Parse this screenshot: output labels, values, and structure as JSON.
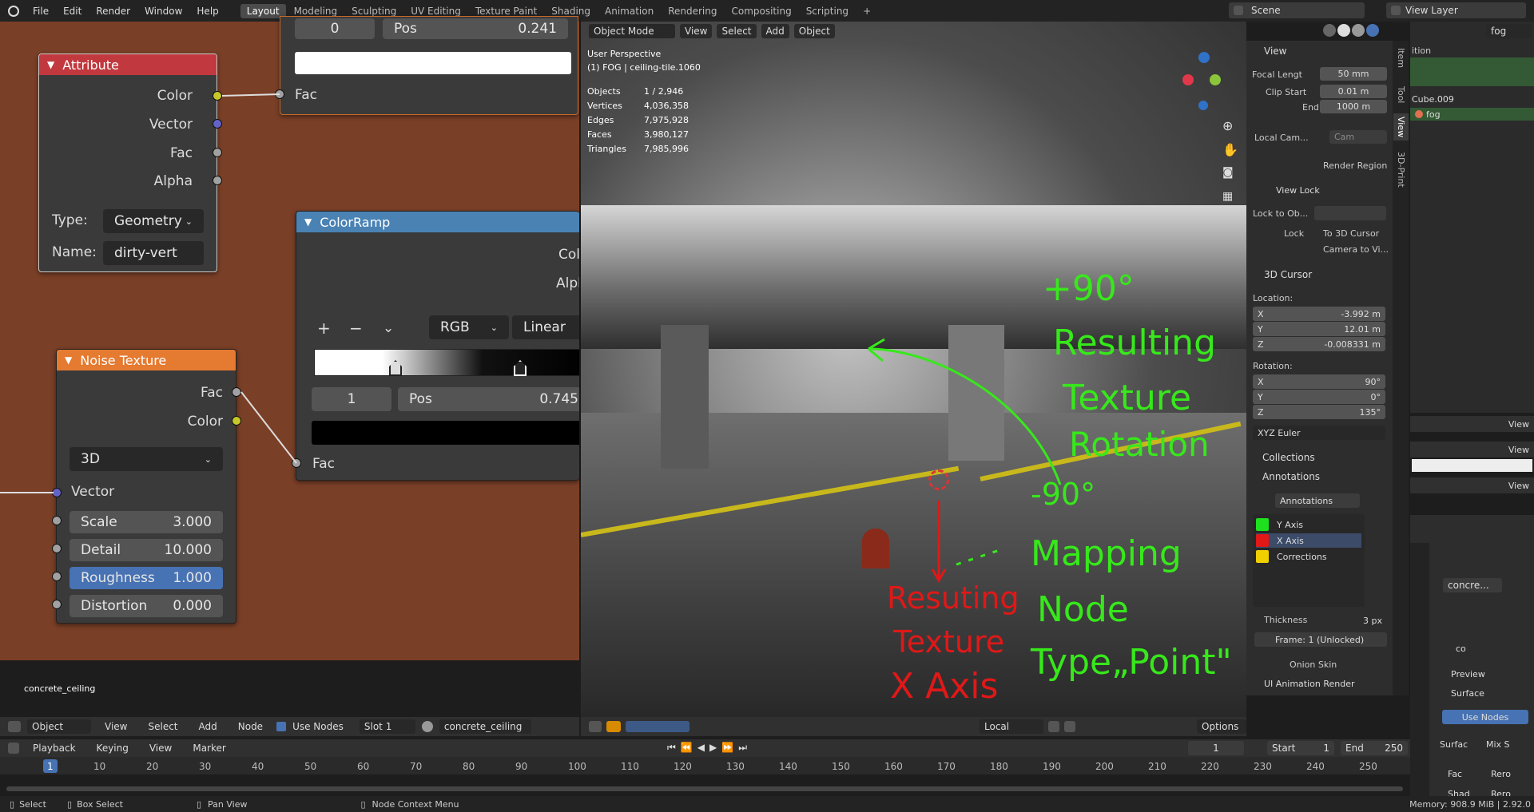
{
  "topbar": {
    "menus": [
      "File",
      "Edit",
      "Render",
      "Window",
      "Help"
    ],
    "workspaces": [
      "Layout",
      "Modeling",
      "Sculpting",
      "UV Editing",
      "Texture Paint",
      "Shading",
      "Animation",
      "Rendering",
      "Compositing",
      "Scripting"
    ],
    "add_tab": "+",
    "scene": "Scene",
    "view_layer": "View Layer"
  },
  "node_editor": {
    "material_name_overlay": "concrete_ceiling",
    "top_node": {
      "value_left": "0",
      "pos_label": "Pos",
      "pos_value": "0.241",
      "fac": "Fac"
    },
    "attribute": {
      "title": "Attribute",
      "outputs": [
        "Color",
        "Vector",
        "Fac",
        "Alpha"
      ],
      "type_label": "Type:",
      "type_value": "Geometry",
      "name_label": "Name:",
      "name_value": "dirty-vert"
    },
    "colorramp": {
      "title": "ColorRamp",
      "out_color": "Col",
      "out_alpha": "Alpl",
      "add": "+",
      "remove": "−",
      "mode": "RGB",
      "interp": "Linear",
      "index": "1",
      "pos_label": "Pos",
      "pos_value": "0.745",
      "fac": "Fac"
    },
    "noise": {
      "title": "Noise Texture",
      "out_fac": "Fac",
      "out_color": "Color",
      "dimensions": "3D",
      "vector": "Vector",
      "fields": [
        {
          "label": "Scale",
          "value": "3.000"
        },
        {
          "label": "Detail",
          "value": "10.000"
        },
        {
          "label": "Roughness",
          "value": "1.000"
        },
        {
          "label": "Distortion",
          "value": "0.000"
        }
      ]
    },
    "header": {
      "editor": "Object",
      "menus": [
        "View",
        "Select",
        "Add",
        "Node"
      ],
      "use_nodes": "Use Nodes",
      "slot": "Slot 1",
      "material": "concrete_ceiling"
    }
  },
  "viewport": {
    "mode": "Object Mode",
    "menus": [
      "View",
      "Select",
      "Add",
      "Object"
    ],
    "perspective": "User Perspective",
    "active": "(1) FOG | ceiling-tile.1060",
    "stats": [
      {
        "label": "Objects",
        "value": "1 / 2,946"
      },
      {
        "label": "Vertices",
        "value": "4,036,358"
      },
      {
        "label": "Edges",
        "value": "7,975,928"
      },
      {
        "label": "Faces",
        "value": "3,980,127"
      },
      {
        "label": "Triangles",
        "value": "7,985,996"
      }
    ],
    "transform": "Local",
    "options": "Options",
    "annotations": {
      "plus90": "+90°",
      "resulting": "Resulting",
      "texture": "Texture",
      "rotation": "Rotation",
      "minus90": "-90°",
      "mapping": "Mapping",
      "node": "Node",
      "type_point": "Type„Point\"",
      "red1": "Resuting",
      "red2": "Texture",
      "red3": "X Axis"
    }
  },
  "npanel": {
    "tabs": [
      "Item",
      "Tool",
      "View",
      "3D-Print"
    ],
    "view_header": "View",
    "focal_label": "Focal Lengt",
    "focal_value": "50 mm",
    "clip_start_label": "Clip Start",
    "clip_start_value": "0.01 m",
    "end_label": "End",
    "end_value": "1000 m",
    "local_cam_label": "Local Cam...",
    "local_cam_value": "Cam",
    "render_region": "Render Region",
    "view_lock": "View Lock",
    "lock_to_obj": "Lock to Ob...",
    "lock_label": "Lock",
    "to_3d_cursor": "To 3D Cursor",
    "camera_to_view": "Camera to Vi...",
    "cursor_header": "3D Cursor",
    "location_label": "Location:",
    "loc": [
      {
        "axis": "X",
        "value": "-3.992 m"
      },
      {
        "axis": "Y",
        "value": "12.01 m"
      },
      {
        "axis": "Z",
        "value": "-0.008331 m"
      }
    ],
    "rotation_label": "Rotation:",
    "rot": [
      {
        "axis": "X",
        "value": "90°"
      },
      {
        "axis": "Y",
        "value": "0°"
      },
      {
        "axis": "Z",
        "value": "135°"
      }
    ],
    "rot_mode": "XYZ Euler",
    "collections": "Collections",
    "annotations_header": "Annotations",
    "annotations_field": "Annotations",
    "layers": [
      {
        "name": "Y Axis",
        "color": "#1ee01e"
      },
      {
        "name": "X Axis",
        "color": "#e01818"
      },
      {
        "name": "Corrections",
        "color": "#f0d000"
      }
    ],
    "thickness_label": "Thickness",
    "thickness_value": "3 px",
    "frame": "Frame: 1 (Unlocked)",
    "onion": "Onion Skin",
    "ui_anim": "UI Animation Render"
  },
  "outliner": {
    "search": "fog",
    "header_partial": "ition",
    "items": [
      "Cube.009",
      "fog"
    ]
  },
  "right_views": [
    "View",
    "View",
    "View"
  ],
  "properties": {
    "material_slot": "concre...",
    "mat_short": "co",
    "c_label": "c",
    "preview": "Preview",
    "surface": "Surface",
    "use_nodes": "Use Nodes",
    "surface_label": "Surfac",
    "mix": "Mix S",
    "fac": "Fac",
    "fac_val": "Rero",
    "shad": "Shad",
    "shad_val": "Rero"
  },
  "timeline": {
    "menus": [
      "Playback",
      "Keying",
      "View",
      "Marker"
    ],
    "current": "1",
    "start_label": "Start",
    "start": "1",
    "end_label": "End",
    "end": "250",
    "ticks": [
      "1",
      "10",
      "20",
      "30",
      "40",
      "50",
      "60",
      "70",
      "80",
      "90",
      "100",
      "110",
      "120",
      "130",
      "140",
      "150",
      "160",
      "170",
      "180",
      "190",
      "200",
      "210",
      "220",
      "230",
      "240",
      "250"
    ]
  },
  "statusbar": {
    "select": "Select",
    "box_select": "Box Select",
    "pan_view": "Pan View",
    "node_context": "Node Context Menu",
    "memory": "Memory: 908.9 MiB | 2.92.0"
  }
}
